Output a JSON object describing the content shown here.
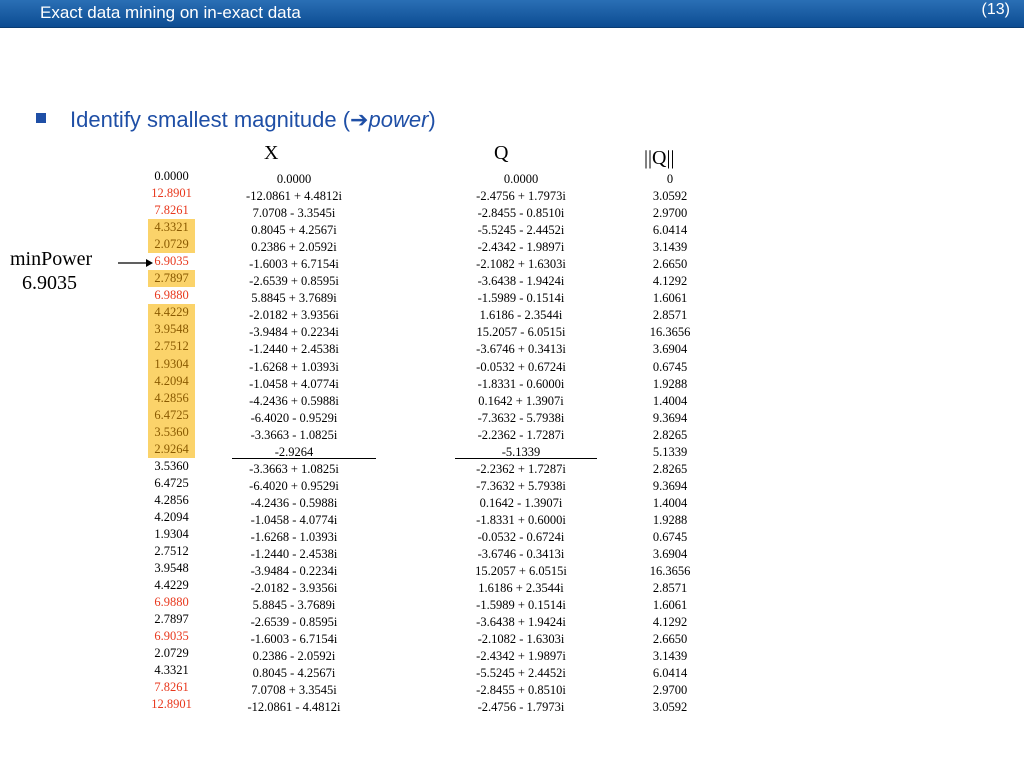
{
  "header": {
    "title": "Exact data mining on in-exact data",
    "page": "(13)"
  },
  "bullet": {
    "text": "Identify smallest magnitude (",
    "arrow": "➔",
    "emph": "power",
    "close": ")"
  },
  "labels": {
    "x": "X",
    "q": "Q",
    "nq": "||Q||",
    "min_label": "minPower",
    "min_value": "6.9035"
  },
  "power": [
    {
      "v": "0.0000",
      "s": ""
    },
    {
      "v": "12.8901",
      "s": "red"
    },
    {
      "v": "7.8261",
      "s": "red"
    },
    {
      "v": "4.3321",
      "s": "hl"
    },
    {
      "v": "2.0729",
      "s": "hl"
    },
    {
      "v": "6.9035",
      "s": "red"
    },
    {
      "v": "2.7897",
      "s": "hl"
    },
    {
      "v": "6.9880",
      "s": "red"
    },
    {
      "v": "4.4229",
      "s": "hl"
    },
    {
      "v": "3.9548",
      "s": "hl"
    },
    {
      "v": "2.7512",
      "s": "hl"
    },
    {
      "v": "1.9304",
      "s": "hl"
    },
    {
      "v": "4.2094",
      "s": "hl"
    },
    {
      "v": "4.2856",
      "s": "hl"
    },
    {
      "v": "6.4725",
      "s": "hl"
    },
    {
      "v": "3.5360",
      "s": "hl"
    },
    {
      "v": "2.9264",
      "s": "hl"
    },
    {
      "v": "3.5360",
      "s": ""
    },
    {
      "v": "6.4725",
      "s": ""
    },
    {
      "v": "4.2856",
      "s": ""
    },
    {
      "v": "4.2094",
      "s": ""
    },
    {
      "v": "1.9304",
      "s": ""
    },
    {
      "v": "2.7512",
      "s": ""
    },
    {
      "v": "3.9548",
      "s": ""
    },
    {
      "v": "4.4229",
      "s": ""
    },
    {
      "v": "6.9880",
      "s": "red"
    },
    {
      "v": "2.7897",
      "s": ""
    },
    {
      "v": "6.9035",
      "s": "red"
    },
    {
      "v": "2.0729",
      "s": ""
    },
    {
      "v": "4.3321",
      "s": ""
    },
    {
      "v": "7.8261",
      "s": "red"
    },
    {
      "v": "12.8901",
      "s": "red"
    }
  ],
  "x": [
    "0.0000",
    "-12.0861 + 4.4812i",
    "7.0708 - 3.3545i",
    "0.8045 + 4.2567i",
    "0.2386 + 2.0592i",
    "-1.6003 + 6.7154i",
    "-2.6539 + 0.8595i",
    "5.8845 + 3.7689i",
    "-2.0182 + 3.9356i",
    "-3.9484 + 0.2234i",
    "-1.2440 + 2.4538i",
    "-1.6268 + 1.0393i",
    "-1.0458 + 4.0774i",
    "-4.2436 + 0.5988i",
    "-6.4020 - 0.9529i",
    "-3.3663 - 1.0825i",
    "-2.9264",
    "-3.3663 + 1.0825i",
    "-6.4020 + 0.9529i",
    "-4.2436 - 0.5988i",
    "-1.0458 - 4.0774i",
    "-1.6268 - 1.0393i",
    "-1.2440 - 2.4538i",
    "-3.9484 - 0.2234i",
    "-2.0182 - 3.9356i",
    "5.8845 - 3.7689i",
    "-2.6539 - 0.8595i",
    "-1.6003 - 6.7154i",
    "0.2386 - 2.0592i",
    "0.8045 - 4.2567i",
    "7.0708 + 3.3545i",
    "-12.0861 - 4.4812i"
  ],
  "q": [
    "0.0000",
    "-2.4756 + 1.7973i",
    "-2.8455 - 0.8510i",
    "-5.5245 - 2.4452i",
    "-2.4342 - 1.9897i",
    "-2.1082 + 1.6303i",
    "-3.6438 - 1.9424i",
    "-1.5989 - 0.1514i",
    "1.6186 - 2.3544i",
    "15.2057 - 6.0515i",
    "-3.6746 + 0.3413i",
    "-0.0532 + 0.6724i",
    "-1.8331 - 0.6000i",
    "0.1642 + 1.3907i",
    "-7.3632 - 5.7938i",
    "-2.2362 - 1.7287i",
    "-5.1339",
    "-2.2362 + 1.7287i",
    "-7.3632 + 5.7938i",
    "0.1642 - 1.3907i",
    "-1.8331 + 0.6000i",
    "-0.0532 - 0.6724i",
    "-3.6746 - 0.3413i",
    "15.2057 + 6.0515i",
    "1.6186 + 2.3544i",
    "-1.5989 + 0.1514i",
    "-3.6438 + 1.9424i",
    "-2.1082 - 1.6303i",
    "-2.4342 + 1.9897i",
    "-5.5245 + 2.4452i",
    "-2.8455 + 0.8510i",
    "-2.4756 - 1.7973i"
  ],
  "nq": [
    "0",
    "3.0592",
    "2.9700",
    "6.0414",
    "3.1439",
    "2.6650",
    "4.1292",
    "1.6061",
    "2.8571",
    "16.3656",
    "3.6904",
    "0.6745",
    "1.9288",
    "1.4004",
    "9.3694",
    "2.8265",
    "5.1339",
    "2.8265",
    "9.3694",
    "1.4004",
    "1.9288",
    "0.6745",
    "3.6904",
    "16.3656",
    "2.8571",
    "1.6061",
    "4.1292",
    "2.6650",
    "3.1439",
    "6.0414",
    "2.9700",
    "3.0592"
  ]
}
